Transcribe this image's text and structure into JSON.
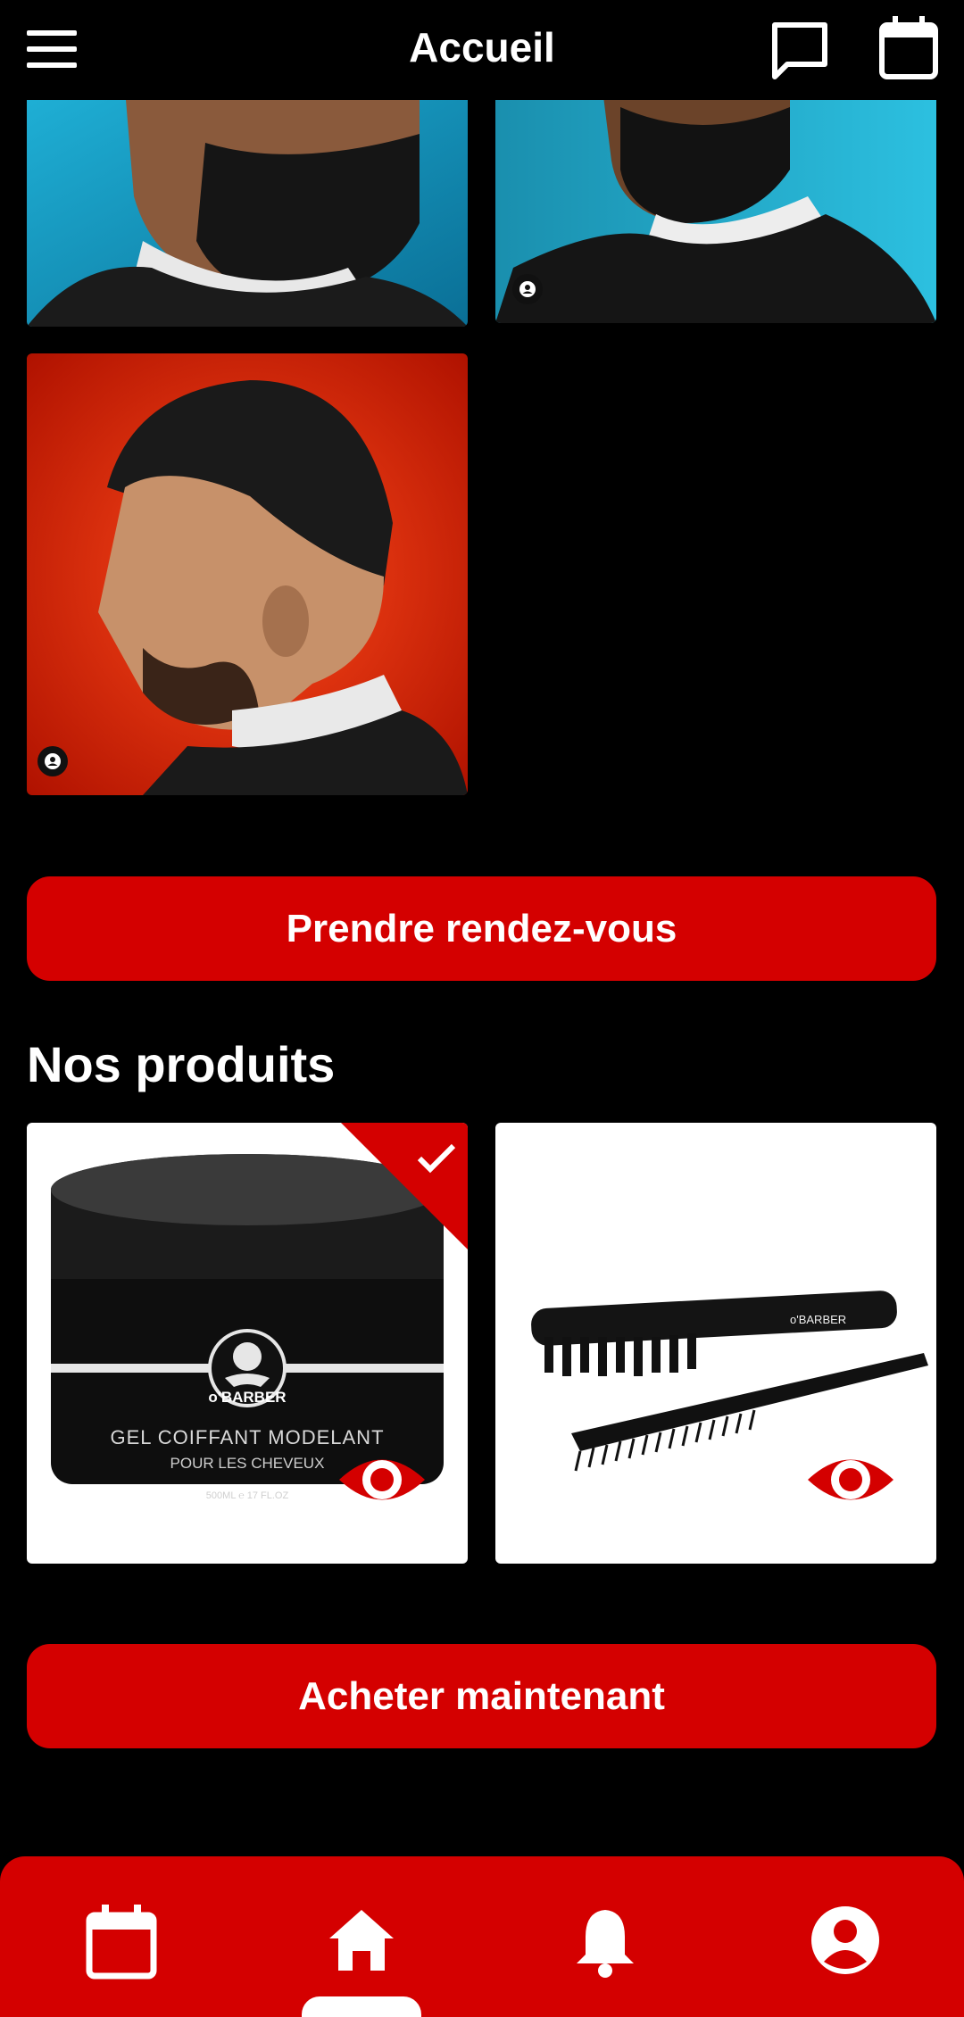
{
  "header": {
    "title": "Accueil",
    "menu_icon": "hamburger-menu-icon",
    "chat_icon": "chat-icon",
    "calendar_icon": "calendar-icon"
  },
  "gallery": {
    "images": [
      {
        "description": "beard-photo-teal-background"
      },
      {
        "description": "beard-photo-teal-background-2"
      },
      {
        "description": "fade-haircut-red-background"
      }
    ]
  },
  "actions": {
    "appointment_label": "Prendre rendez-vous",
    "buy_label": "Acheter maintenant"
  },
  "products": {
    "title": "Nos produits",
    "items": [
      {
        "brand": "o'BARBER",
        "name": "GEL COIFFANT MODELANT",
        "subtitle": "POUR LES CHEVEUX",
        "volume": "500ML ℮ 17 FL.OZ",
        "selected": true
      },
      {
        "brand": "o'BARBER",
        "selected": false
      }
    ]
  },
  "bottom_nav": {
    "items": [
      "calendar-icon",
      "home-icon",
      "bell-icon",
      "account-icon"
    ],
    "active": "home-icon"
  },
  "colors": {
    "accent": "#d40000",
    "background": "#000000"
  }
}
